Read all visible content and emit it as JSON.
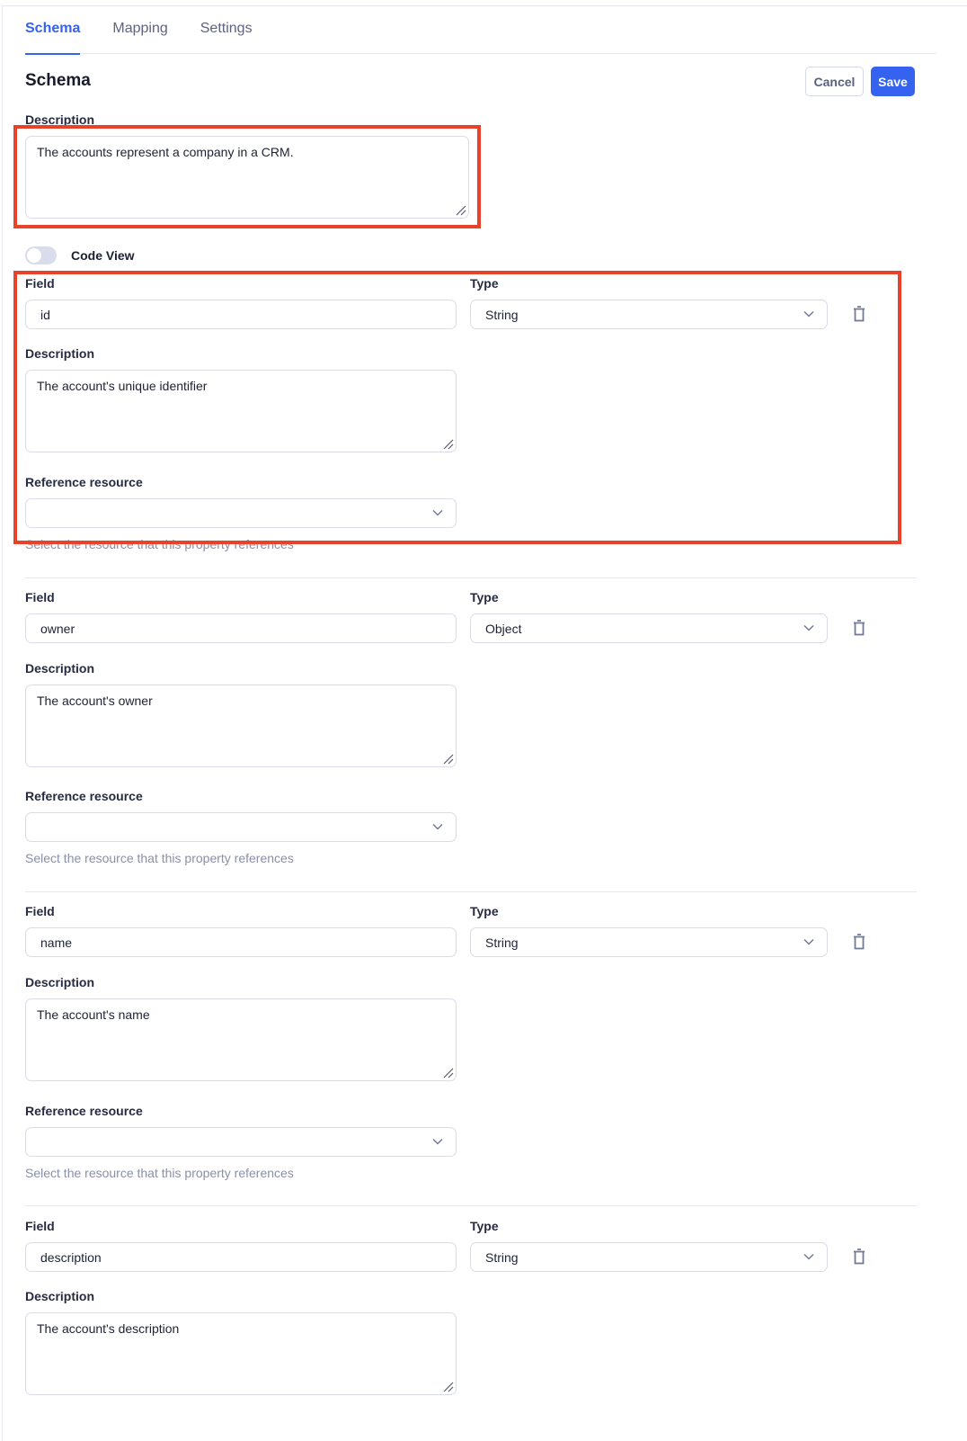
{
  "tabs": [
    {
      "label": "Schema",
      "active": true
    },
    {
      "label": "Mapping",
      "active": false
    },
    {
      "label": "Settings",
      "active": false
    }
  ],
  "header": {
    "title": "Schema",
    "cancel_label": "Cancel",
    "save_label": "Save"
  },
  "schema": {
    "description_label": "Description",
    "description_value": "The accounts represent a company in a CRM."
  },
  "code_view": {
    "label": "Code View",
    "enabled": false
  },
  "properties": [
    {
      "field_label": "Field",
      "field_value": "id",
      "type_label": "Type",
      "type_value": "String",
      "description_label": "Description",
      "description_value": "The account's unique identifier",
      "reference_label": "Reference resource",
      "reference_value": "",
      "reference_helper": "Select the resource that this property references"
    },
    {
      "field_label": "Field",
      "field_value": "owner",
      "type_label": "Type",
      "type_value": "Object",
      "description_label": "Description",
      "description_value": "The account's owner",
      "reference_label": "Reference resource",
      "reference_value": "",
      "reference_helper": "Select the resource that this property references"
    },
    {
      "field_label": "Field",
      "field_value": "name",
      "type_label": "Type",
      "type_value": "String",
      "description_label": "Description",
      "description_value": "The account's name",
      "reference_label": "Reference resource",
      "reference_value": "",
      "reference_helper": "Select the resource that this property references"
    },
    {
      "field_label": "Field",
      "field_value": "description",
      "type_label": "Type",
      "type_value": "String",
      "description_label": "Description",
      "description_value": "The account's description"
    }
  ],
  "icons": {
    "delete": "trash-icon",
    "dropdown": "chevron-down-icon",
    "resize": "resize-grip-icon"
  },
  "colors": {
    "accent": "#3563f0",
    "highlight": "#e8432a",
    "border": "#d9dce8",
    "helper_text": "#8a8fa8"
  }
}
